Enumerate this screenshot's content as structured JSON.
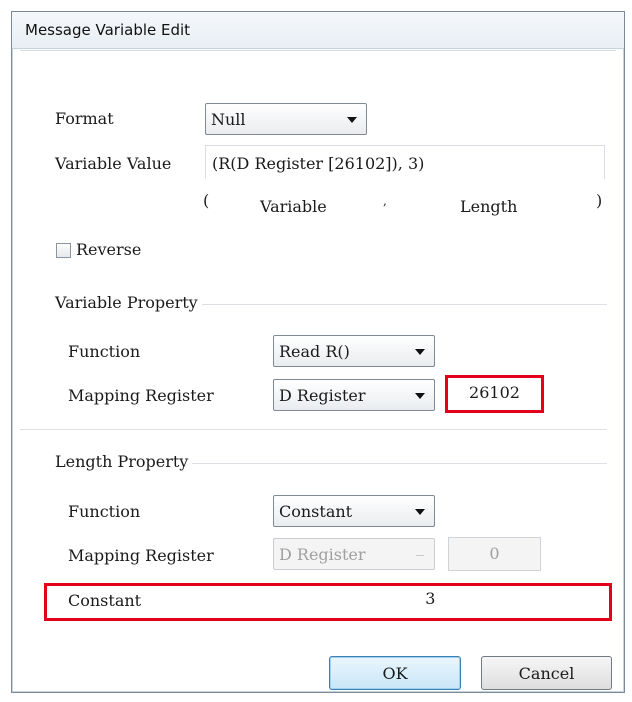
{
  "window": {
    "title": "Message Variable Edit"
  },
  "format": {
    "label": "Format",
    "selected": "Null"
  },
  "variable_value": {
    "label": "Variable Value",
    "value": "(R(D Register [26102]), 3)",
    "hint_open": "(",
    "hint_variable": "Variable",
    "hint_separator": ",",
    "hint_length": "Length",
    "hint_close": ")"
  },
  "reverse": {
    "label": "Reverse",
    "checked": false
  },
  "variable_property": {
    "heading": "Variable Property",
    "function_label": "Function",
    "function_selected": "Read R()",
    "mapping_label": "Mapping Register",
    "mapping_selected": "D Register",
    "address": "26102"
  },
  "length_property": {
    "heading": "Length Property",
    "function_label": "Function",
    "function_selected": "Constant",
    "mapping_label": "Mapping Register",
    "mapping_selected": "D Register",
    "address": "0",
    "constant_label": "Constant",
    "constant_value": "3"
  },
  "buttons": {
    "ok": "OK",
    "cancel": "Cancel"
  },
  "colors": {
    "highlight": "#e3001b",
    "default_button": "#3c7fb1"
  }
}
